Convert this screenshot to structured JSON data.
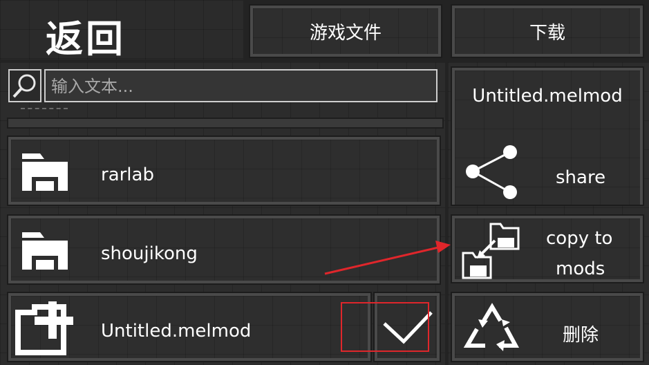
{
  "header": {
    "back_label": "返回",
    "game_files_label": "游戏文件",
    "download_label": "下载"
  },
  "search": {
    "placeholder": "输入文本..."
  },
  "files": [
    {
      "name": "rarlab",
      "icon": "folder-icon"
    },
    {
      "name": "shoujikong",
      "icon": "folder-icon"
    },
    {
      "name": "Untitled.melmod",
      "icon": "mod-file-icon"
    }
  ],
  "side_panel": {
    "selected_file": "Untitled.melmod",
    "share_label": "share",
    "copy_label_line1": "copy to",
    "copy_label_line2": "mods",
    "delete_label": "删除"
  },
  "colors": {
    "annotation_red": "#e0262b",
    "panel_bg": "#333333",
    "button_border": "#4a4a4a"
  }
}
